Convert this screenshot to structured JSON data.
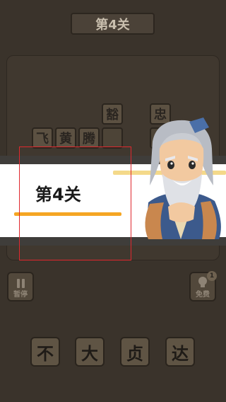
{
  "header": {
    "level_label": "第4关"
  },
  "board": {
    "tiles": [
      {
        "text": "飞"
      },
      {
        "text": "黄"
      },
      {
        "text": "腾"
      },
      {
        "text": ""
      },
      {
        "text": "豁"
      },
      {
        "text": "忠"
      },
      {
        "text": ""
      }
    ]
  },
  "banner": {
    "title": "第4关"
  },
  "controls": {
    "pause_label": "暂停",
    "hint_label": "免费",
    "hint_badge": "1"
  },
  "choices": [
    {
      "text": "不"
    },
    {
      "text": "大"
    },
    {
      "text": "贞"
    },
    {
      "text": "达"
    }
  ],
  "colors": {
    "accent_line": "#f5a623",
    "highlight_border": "#e0282e"
  }
}
